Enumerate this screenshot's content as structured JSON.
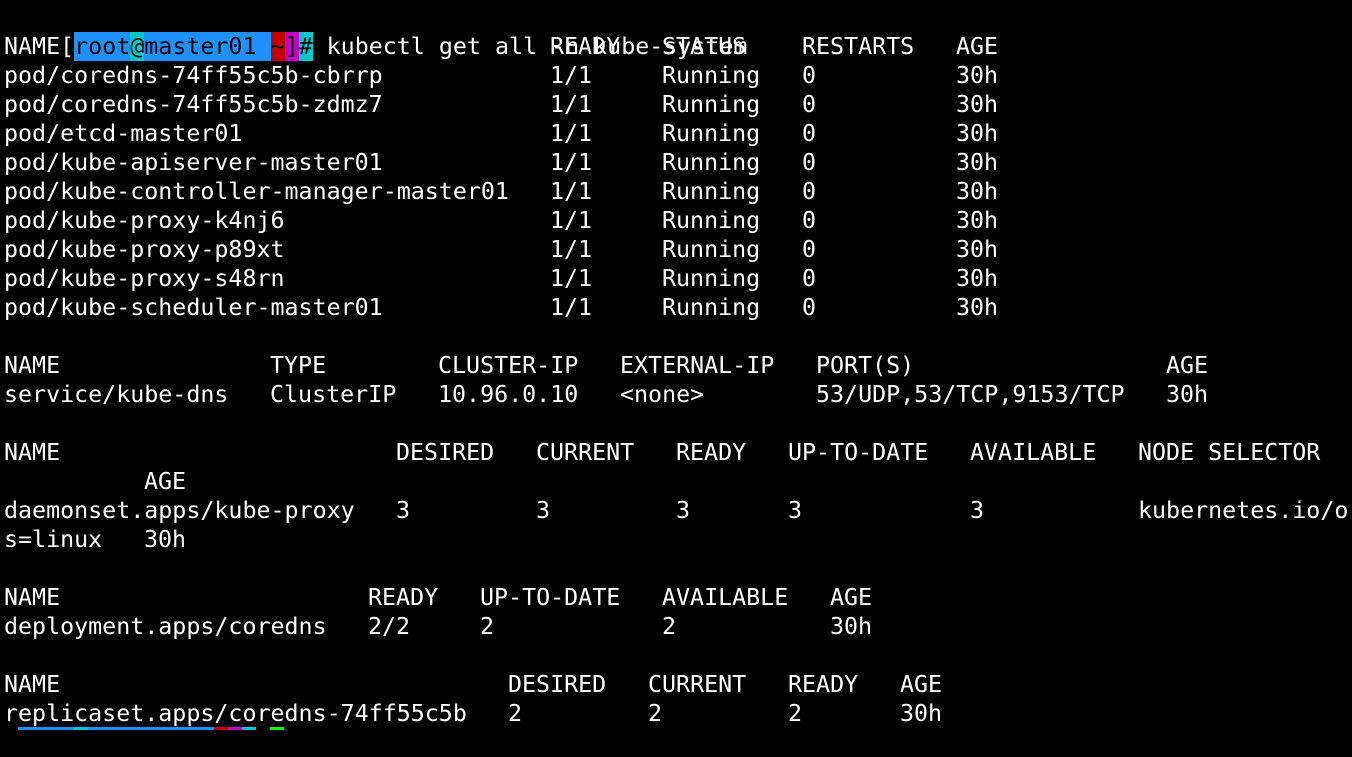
{
  "prompt": {
    "open_bracket": "[",
    "user": "root",
    "at": "@",
    "host": "master01",
    "space": " ",
    "path": "~",
    "close_bracket": "]",
    "hash": "#",
    "command": " kubectl get all -n kube-system"
  },
  "colors": {
    "background": "#000000",
    "text": "#ffffff",
    "prompt_user": "#1e90ff",
    "prompt_at": "#00c8c8",
    "prompt_path": "#c00000",
    "prompt_bracket": "#c000c0",
    "cursor": "#00ff00"
  },
  "pods": {
    "headers": [
      "NAME",
      "READY",
      "STATUS",
      "RESTARTS",
      "AGE"
    ],
    "rows": [
      [
        "pod/coredns-74ff55c5b-cbrrp",
        "1/1",
        "Running",
        "0",
        "30h"
      ],
      [
        "pod/coredns-74ff55c5b-zdmz7",
        "1/1",
        "Running",
        "0",
        "30h"
      ],
      [
        "pod/etcd-master01",
        "1/1",
        "Running",
        "0",
        "30h"
      ],
      [
        "pod/kube-apiserver-master01",
        "1/1",
        "Running",
        "0",
        "30h"
      ],
      [
        "pod/kube-controller-manager-master01",
        "1/1",
        "Running",
        "0",
        "30h"
      ],
      [
        "pod/kube-proxy-k4nj6",
        "1/1",
        "Running",
        "0",
        "30h"
      ],
      [
        "pod/kube-proxy-p89xt",
        "1/1",
        "Running",
        "0",
        "30h"
      ],
      [
        "pod/kube-proxy-s48rn",
        "1/1",
        "Running",
        "0",
        "30h"
      ],
      [
        "pod/kube-scheduler-master01",
        "1/1",
        "Running",
        "0",
        "30h"
      ]
    ]
  },
  "services": {
    "headers": [
      "NAME",
      "TYPE",
      "CLUSTER-IP",
      "EXTERNAL-IP",
      "PORT(S)",
      "AGE"
    ],
    "rows": [
      [
        "service/kube-dns",
        "ClusterIP",
        "10.96.0.10",
        "<none>",
        "53/UDP,53/TCP,9153/TCP",
        "30h"
      ]
    ]
  },
  "daemonsets": {
    "headers": [
      "NAME",
      "DESIRED",
      "CURRENT",
      "READY",
      "UP-TO-DATE",
      "AVAILABLE",
      "NODE SELECTOR"
    ],
    "wrapped_header": "AGE",
    "row": [
      "daemonset.apps/kube-proxy",
      "3",
      "3",
      "3",
      "3",
      "3",
      "kubernetes.io/o"
    ],
    "wrapped_row": [
      "s=linux",
      "30h"
    ]
  },
  "deployments": {
    "headers": [
      "NAME",
      "READY",
      "UP-TO-DATE",
      "AVAILABLE",
      "AGE"
    ],
    "rows": [
      [
        "deployment.apps/coredns",
        "2/2",
        "2",
        "2",
        "30h"
      ]
    ]
  },
  "replicasets": {
    "headers": [
      "NAME",
      "DESIRED",
      "CURRENT",
      "READY",
      "AGE"
    ],
    "rows": [
      [
        "replicaset.apps/coredns-74ff55c5b",
        "2",
        "2",
        "2",
        "30h"
      ]
    ]
  }
}
